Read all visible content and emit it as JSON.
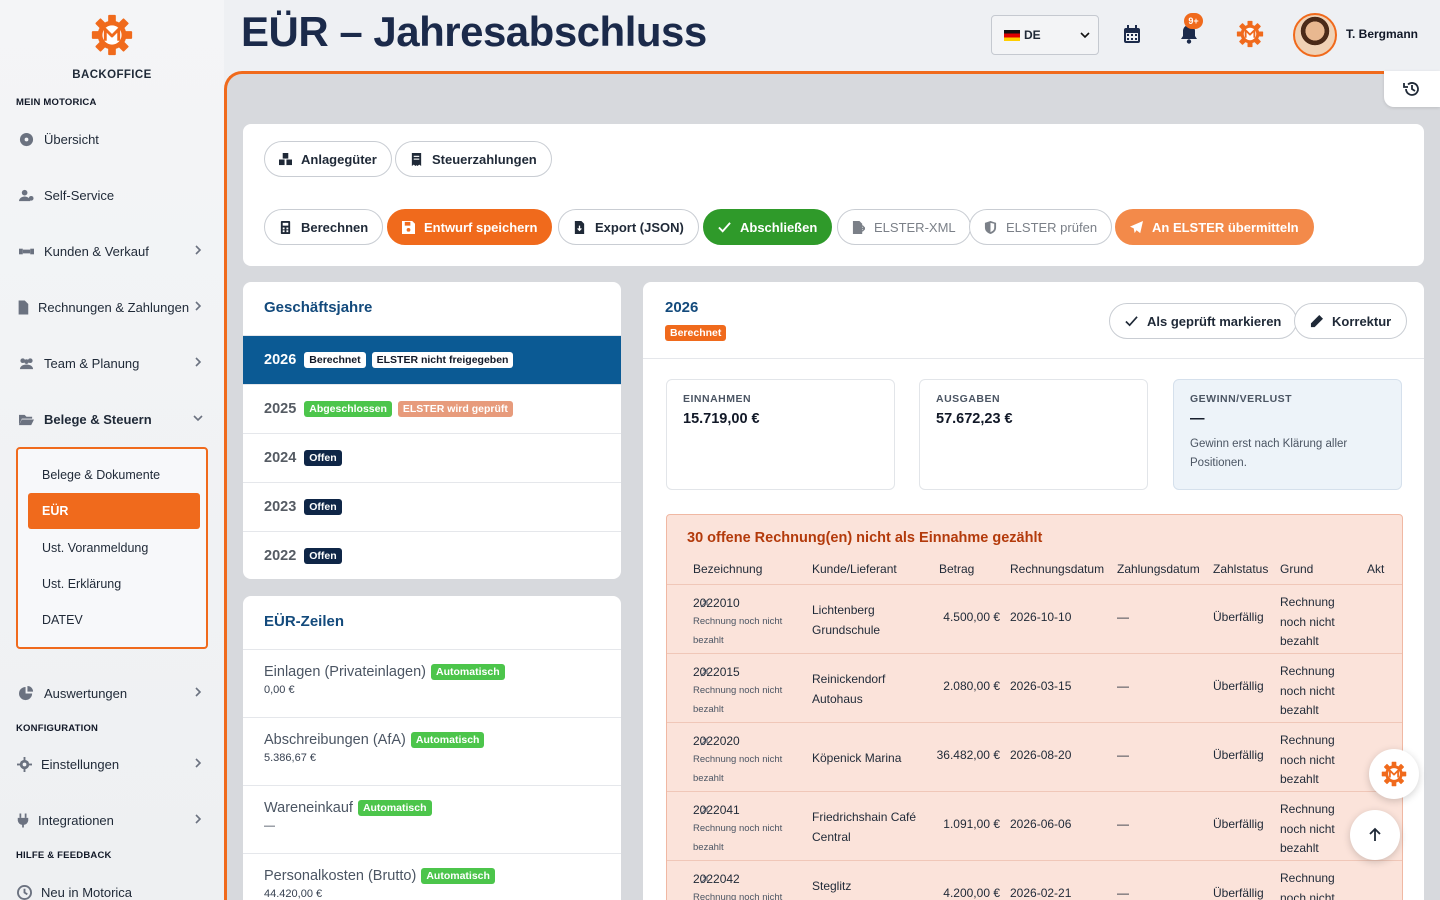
{
  "sidebar": {
    "brand": "BACKOFFICE",
    "sections": {
      "mein": "MEIN MOTORICA",
      "konfig": "KONFIGURATION",
      "hilfe": "HILFE & FEEDBACK"
    },
    "items": {
      "uebersicht": "Übersicht",
      "selfservice": "Self-Service",
      "kunden": "Kunden & Verkauf",
      "rechnungen": "Rechnungen & Zahlungen",
      "team": "Team & Planung",
      "belege": "Belege & Steuern",
      "auswertungen": "Auswertungen",
      "einstellungen": "Einstellungen",
      "integrationen": "Integrationen",
      "neu": "Neu in Motorica"
    },
    "submenu": {
      "belege_dok": "Belege & Dokumente",
      "eur": "EÜR",
      "ust_voranm": "Ust. Voranmeldung",
      "ust_erkl": "Ust. Erklärung",
      "datev": "DATEV"
    }
  },
  "header": {
    "title": "EÜR – Jahresabschluss",
    "language": "DE",
    "notification_count": "9+",
    "user_name": "T. Bergmann"
  },
  "toolbar": {
    "anlagegueter": "Anlagegüter",
    "steuerzahlungen": "Steuerzahlungen",
    "berechnen": "Berechnen",
    "entwurf": "Entwurf speichern",
    "export": "Export (JSON)",
    "abschliessen": "Abschließen",
    "elster_xml": "ELSTER-XML",
    "elster_pruefen": "ELSTER prüfen",
    "elster_senden": "An ELSTER übermitteln"
  },
  "years": {
    "title": "Geschäftsjahre",
    "rows": [
      {
        "year": "2026",
        "badge1": "Berechnet",
        "badge2": "ELSTER nicht freigegeben"
      },
      {
        "year": "2025",
        "badge1": "Abgeschlossen",
        "badge2": "ELSTER wird geprüft"
      },
      {
        "year": "2024",
        "badge1": "Offen"
      },
      {
        "year": "2023",
        "badge1": "Offen"
      },
      {
        "year": "2022",
        "badge1": "Offen"
      }
    ]
  },
  "zeilen": {
    "title": "EÜR-Zeilen",
    "rows": [
      {
        "label": "Einlagen (Privateinlagen)",
        "badge": "Automatisch",
        "value": "0,00 €"
      },
      {
        "label": "Abschreibungen (AfA)",
        "badge": "Automatisch",
        "value": "5.386,67 €"
      },
      {
        "label": "Wareneinkauf",
        "badge": "Automatisch",
        "value": "—"
      },
      {
        "label": "Personalkosten (Brutto)",
        "badge": "Automatisch",
        "value": "44.420,00 €"
      }
    ]
  },
  "detail": {
    "year": "2026",
    "status": "Berechnet",
    "mark_checked": "Als geprüft markieren",
    "korrektur": "Korrektur",
    "einnahmen_label": "EINNAHMEN",
    "einnahmen_value": "15.719,00 €",
    "ausgaben_label": "AUSGABEN",
    "ausgaben_value": "57.672,23 €",
    "gewinn_label": "GEWINN/VERLUST",
    "gewinn_value": "—",
    "gewinn_note": "Gewinn erst nach Klärung aller Positionen."
  },
  "warning": {
    "title": "30 offene Rechnung(en) nicht als Einnahme gezählt",
    "columns": {
      "bez": "Bezeichnung",
      "kunde": "Kunde/Lieferant",
      "betrag": "Betrag",
      "rdat": "Rechnungsdatum",
      "zdat": "Zahlungsdatum",
      "zst": "Zahlstatus",
      "grund": "Grund",
      "akt": "Akt"
    },
    "rows": [
      {
        "nr": "2022010",
        "sub": "Rechnung noch nicht bezahlt",
        "kunde": "Lichtenberg Grundschule",
        "betrag": "4.500,00 €",
        "rdat": "2026-10-10",
        "zdat": "—",
        "zst": "Überfällig",
        "grund": "Rechnung noch nicht bezahlt"
      },
      {
        "nr": "2022015",
        "sub": "Rechnung noch nicht bezahlt",
        "kunde": "Reinickendorf Autohaus",
        "betrag": "2.080,00 €",
        "rdat": "2026-03-15",
        "zdat": "—",
        "zst": "Überfällig",
        "grund": "Rechnung noch nicht bezahlt"
      },
      {
        "nr": "2022020",
        "sub": "Rechnung noch nicht bezahlt",
        "kunde": "Köpenick Marina",
        "betrag": "36.482,00 €",
        "rdat": "2026-08-20",
        "zdat": "—",
        "zst": "Überfällig",
        "grund": "Rechnung noch nicht bezahlt"
      },
      {
        "nr": "2022041",
        "sub": "Rechnung noch nicht bezahlt",
        "kunde": "Friedrichshain Café Central",
        "betrag": "1.091,00 €",
        "rdat": "2026-06-06",
        "zdat": "—",
        "zst": "Überfällig",
        "grund": "Rechnung noch nicht bezahlt"
      },
      {
        "nr": "2022042",
        "sub": "Rechnung noch nicht bezahlt",
        "kunde": "Steglitz",
        "betrag": "4.200,00 €",
        "rdat": "2026-02-21",
        "zdat": "—",
        "zst": "Überfällig",
        "grund": "Rechnung noch nicht bezahlt"
      }
    ]
  },
  "colors": {
    "accent": "#f06a1c",
    "navy": "#1b2a4a",
    "selected": "#0b5a94",
    "success": "#2f9a2a"
  }
}
